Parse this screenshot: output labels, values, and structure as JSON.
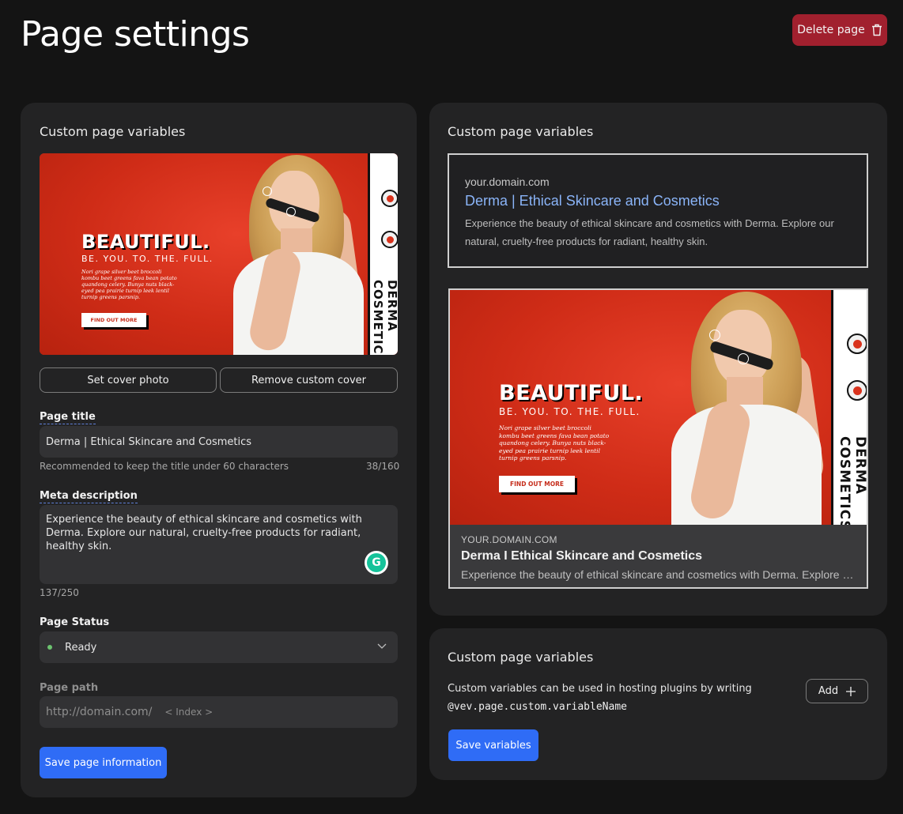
{
  "header": {
    "title": "Page settings",
    "delete_label": "Delete page"
  },
  "left_panel": {
    "heading": "Custom page variables",
    "cover": {
      "headline": "BEAUTIFUL.",
      "subheadline": "BE. YOU. TO. THE. FULL.",
      "blurb": "Nori grape silver beet broccoli kombu beet greens fava bean potato quandong celery. Bunya nuts black-eyed pea prairie turnip leek lentil turnip greens parsnip.",
      "cta": "FIND OUT MORE",
      "brand": "DERMA COSMETICS",
      "badge_texts": [
        "CRUELTY",
        "RECYCLE"
      ]
    },
    "set_cover_label": "Set cover photo",
    "remove_cover_label": "Remove custom cover",
    "page_title_label": "Page title",
    "page_title_value": "Derma | Ethical Skincare and Cosmetics",
    "title_hint": "Recommended to keep the title under 60 characters",
    "title_count": "38/160",
    "meta_label": "Meta description",
    "meta_value": "Experience the beauty of ethical skincare and cosmetics with Derma. Explore our natural, cruelty-free products for radiant, healthy skin.",
    "meta_count": "137/250",
    "status_label": "Page Status",
    "status_value": "Ready",
    "status_color": "#6cc36f",
    "path_label": "Page path",
    "path_value": "http://domain.com/",
    "path_placeholder": "< Index >",
    "save_label": "Save page information"
  },
  "preview_panel": {
    "heading": "Custom page variables",
    "serp": {
      "url": "your.domain.com",
      "title": "Derma | Ethical Skincare and Cosmetics",
      "desc": "Experience the beauty of ethical skincare and cosmetics with Derma. Explore our natural, cruelty-free products for radiant, healthy skin."
    },
    "social": {
      "url": "YOUR.DOMAIN.COM",
      "title": "Derma I Ethical Skincare and Cosmetics",
      "desc": "Experience the beauty of ethical skincare and cosmetics with Derma. Explore our natural, cruelty-free products for radiant, healthy skin."
    }
  },
  "variables_panel": {
    "heading": "Custom page variables",
    "description": "Custom variables can be used in hosting plugins by writing",
    "code": "@vev.page.custom.variableName",
    "add_label": "Add",
    "save_label": "Save variables"
  },
  "colors": {
    "background": "#141414",
    "panel": "#232324",
    "primary": "#2f6cf6",
    "danger": "#a1202e",
    "link": "#8ab4f8"
  }
}
